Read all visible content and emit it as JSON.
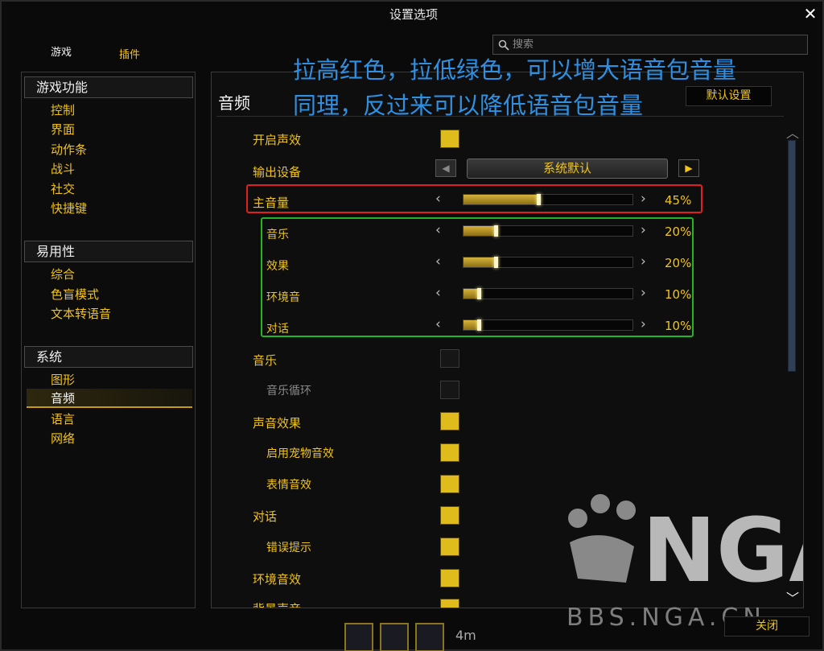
{
  "window": {
    "title": "设置选项",
    "close_glyph": "✕"
  },
  "top_tabs": [
    {
      "label": "游戏"
    },
    {
      "label": "插件"
    }
  ],
  "search": {
    "placeholder": "搜索",
    "value": ""
  },
  "sidebar": {
    "categories": [
      {
        "header": "游戏功能",
        "items": [
          "控制",
          "界面",
          "动作条",
          "战斗",
          "社交",
          "快捷键"
        ]
      },
      {
        "header": "易用性",
        "items": [
          "综合",
          "色盲模式",
          "文本转语音"
        ]
      },
      {
        "header": "系统",
        "items": [
          "图形",
          "音频",
          "语言",
          "网络"
        ]
      }
    ],
    "active_item": "音频"
  },
  "panel": {
    "title": "音频",
    "default_button": "默认设置",
    "enable_sound": {
      "label": "开启声效",
      "checked": true
    },
    "output_device": {
      "label": "输出设备",
      "value": "系统默认"
    },
    "sliders": [
      {
        "label": "主音量",
        "value_text": "45%",
        "fraction": 0.45
      },
      {
        "label": "音乐",
        "value_text": "20%",
        "fraction": 0.2
      },
      {
        "label": "效果",
        "value_text": "20%",
        "fraction": 0.2
      },
      {
        "label": "环境音",
        "value_text": "10%",
        "fraction": 0.1
      },
      {
        "label": "对话",
        "value_text": "10%",
        "fraction": 0.1
      }
    ],
    "checkboxes": [
      {
        "label": "音乐",
        "checked": false
      },
      {
        "label": "音乐循环",
        "checked": false,
        "dimmed": true
      },
      {
        "label": "声音效果",
        "checked": true
      },
      {
        "label": "启用宠物音效",
        "checked": true
      },
      {
        "label": "表情音效",
        "checked": true
      },
      {
        "label": "对话",
        "checked": true
      },
      {
        "label": "错误提示",
        "checked": true
      },
      {
        "label": "环境音效",
        "checked": true
      },
      {
        "label": "背景声音",
        "checked": true
      }
    ]
  },
  "annotation": {
    "line1": "拉高红色，拉低绿色，可以增大语音包音量",
    "line2": "同理，反过来可以降低语音包音量"
  },
  "watermark": {
    "logo_text": "NGA",
    "site_text": "BBS.NGA.CN"
  },
  "bottom": {
    "close_button": "关闭",
    "slot_text": "4m"
  },
  "colors": {
    "accent": "#f0c419",
    "red_highlight": "#e02020",
    "green_highlight": "#23b523",
    "annotation": "#2f8fe0"
  }
}
